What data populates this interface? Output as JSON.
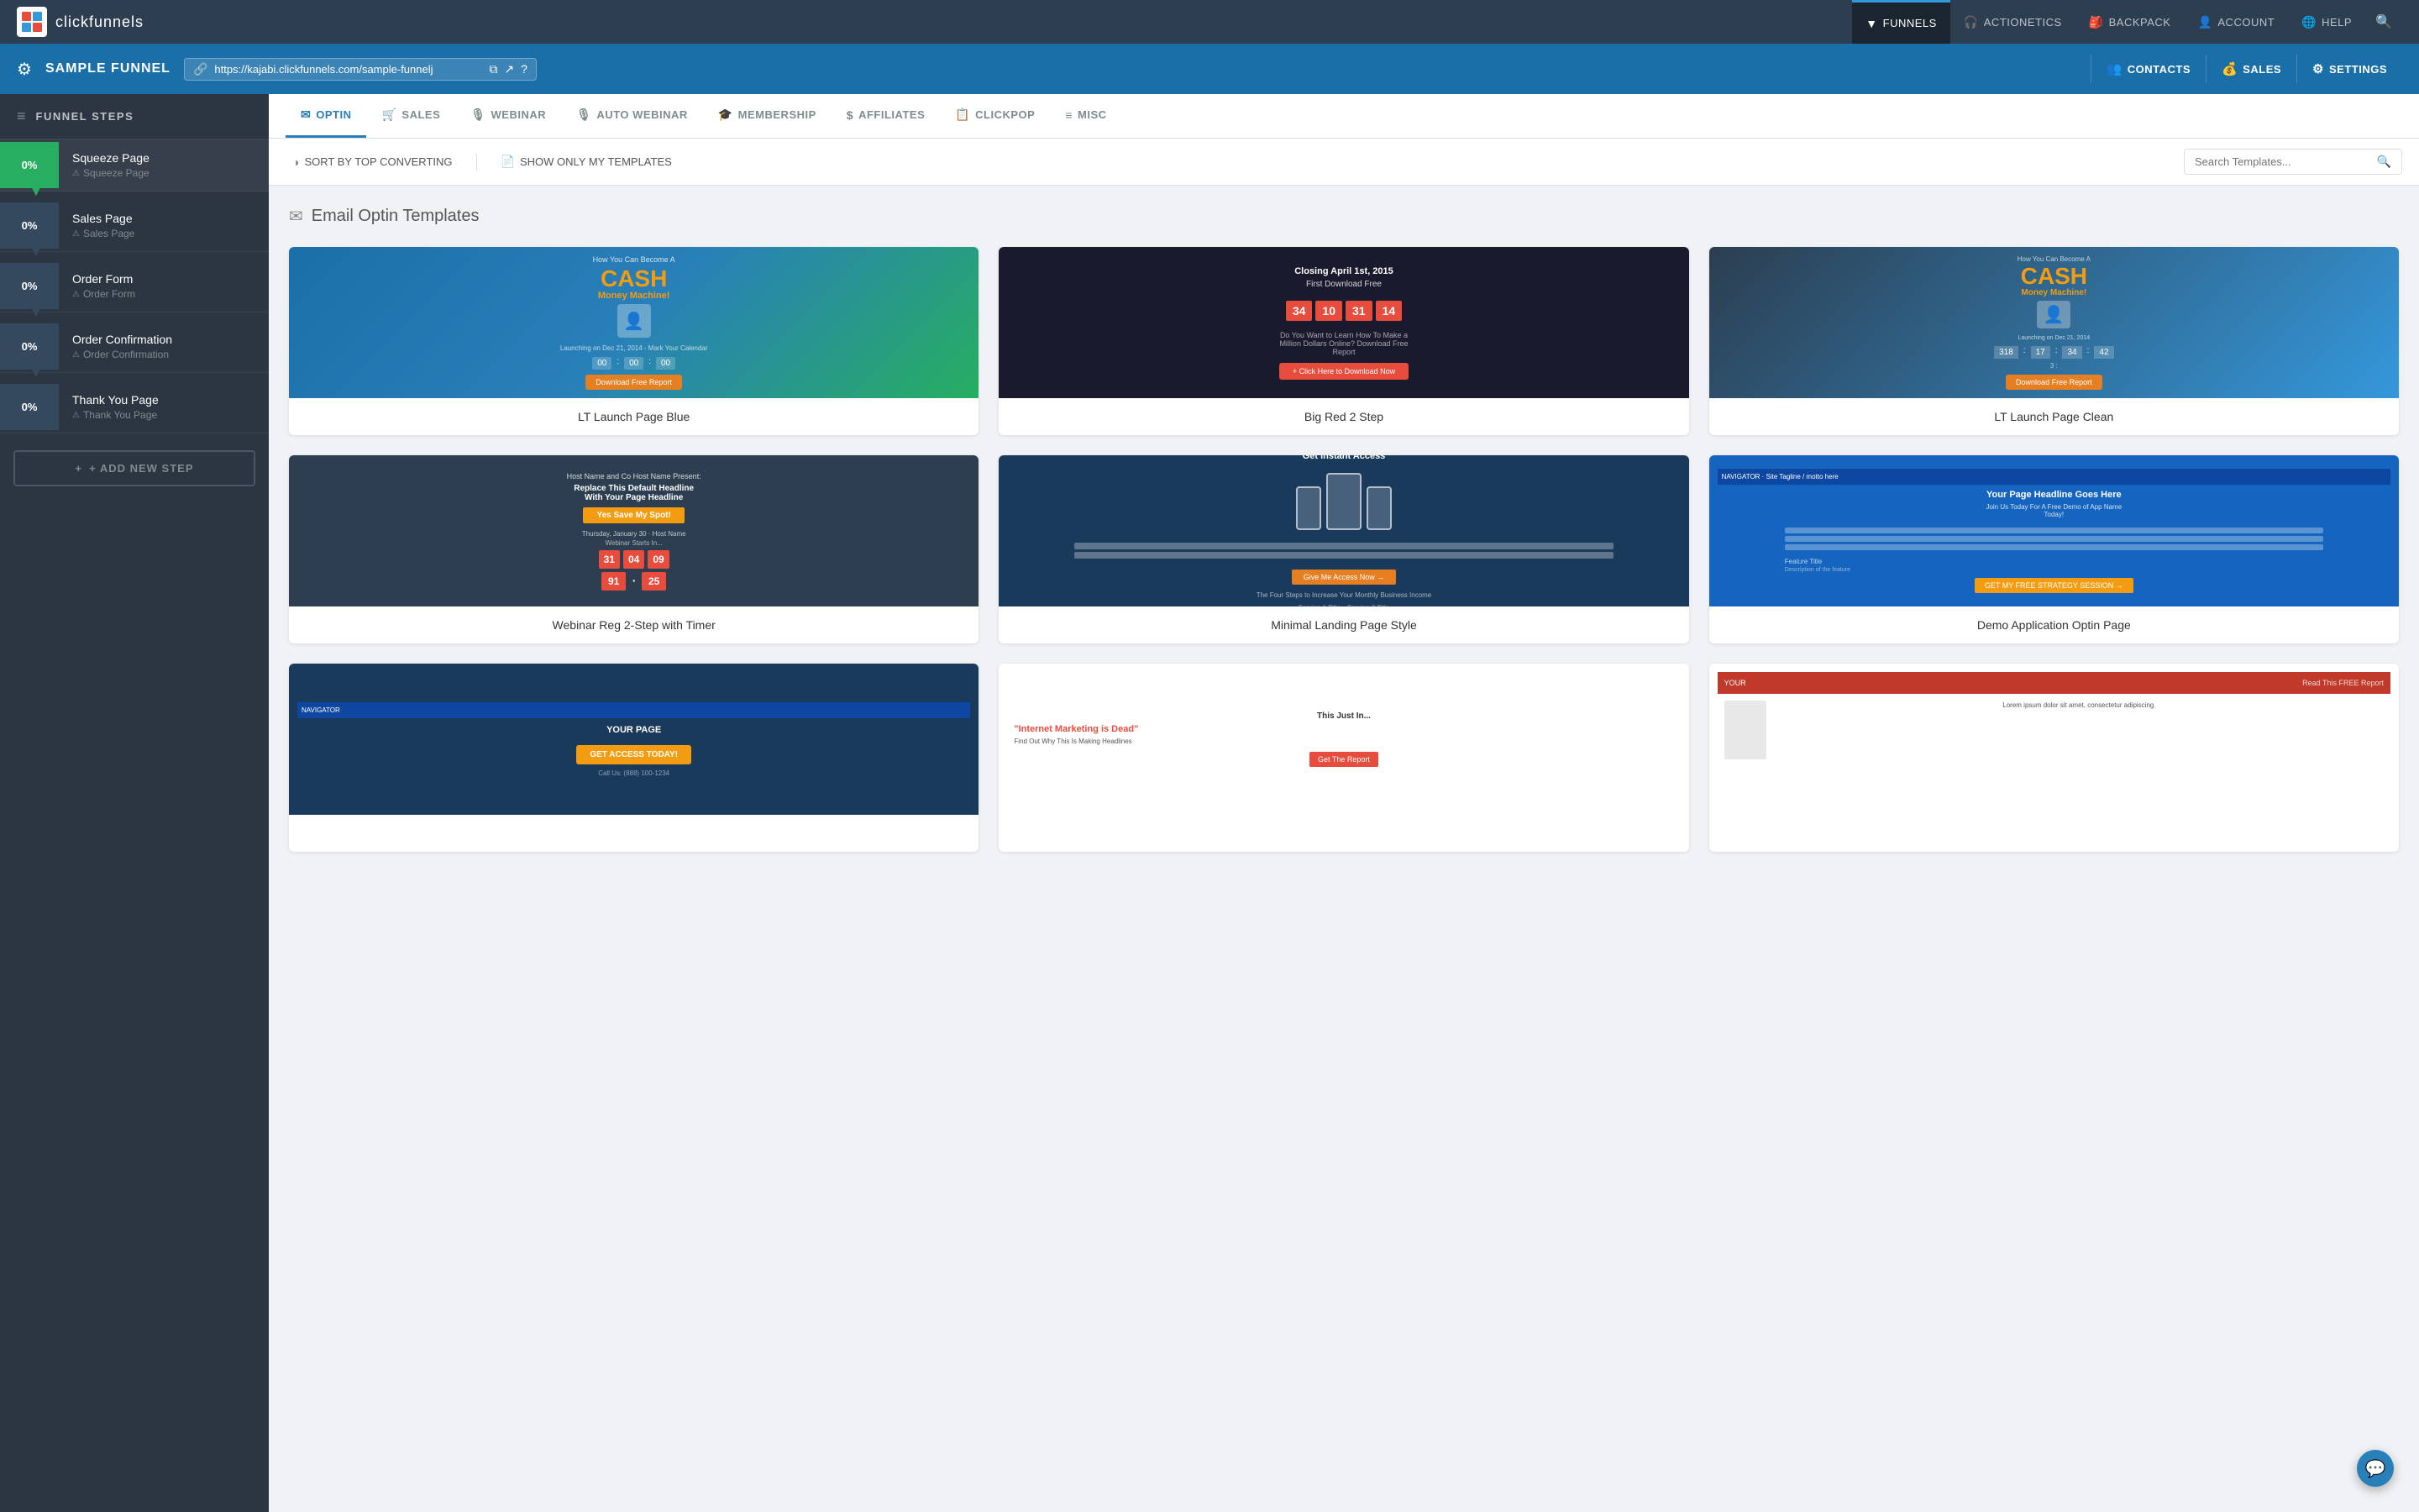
{
  "app": {
    "logo_icon": "CF",
    "logo_text": "clickfunnels"
  },
  "top_nav": {
    "items": [
      {
        "id": "funnels",
        "label": "FUNNELS",
        "icon": "▼",
        "active": true
      },
      {
        "id": "actionetics",
        "label": "ACTIONETICS",
        "icon": "🎧"
      },
      {
        "id": "backpack",
        "label": "BACKPACK",
        "icon": "🎒"
      },
      {
        "id": "account",
        "label": "ACCOUNT",
        "icon": "👤"
      },
      {
        "id": "help",
        "label": "HELP",
        "icon": "🌐"
      }
    ],
    "search_icon": "🔍"
  },
  "funnel_header": {
    "gear_icon": "⚙",
    "title": "SAMPLE FUNNEL",
    "url": "https://kajabi.clickfunnels.com/sample-funnelj",
    "url_icon": "🔗",
    "copy_icon": "⧉",
    "external_icon": "↗",
    "help_icon": "?",
    "buttons": [
      {
        "id": "contacts",
        "label": "CONTACTS",
        "icon": "👥"
      },
      {
        "id": "sales",
        "label": "SALES",
        "icon": "💰"
      },
      {
        "id": "settings",
        "label": "SETTINGS",
        "icon": "⚙"
      }
    ]
  },
  "sidebar": {
    "header_icon": "≡",
    "header_title": "FUNNEL STEPS",
    "steps": [
      {
        "id": "squeeze",
        "name": "Squeeze Page",
        "sub": "Squeeze Page",
        "percent": "0%",
        "active": true
      },
      {
        "id": "sales",
        "name": "Sales Page",
        "sub": "Sales Page",
        "percent": "0%"
      },
      {
        "id": "order-form",
        "name": "Order Form",
        "sub": "Order Form",
        "percent": "0%"
      },
      {
        "id": "order-confirm",
        "name": "Order Confirmation",
        "sub": "Order Confirmation",
        "percent": "0%"
      },
      {
        "id": "thank-you",
        "name": "Thank You Page",
        "sub": "Thank You Page",
        "percent": "0%"
      }
    ],
    "add_step_label": "+ ADD NEW STEP"
  },
  "tabs": [
    {
      "id": "optin",
      "label": "OPTIN",
      "icon": "✉",
      "active": true
    },
    {
      "id": "sales",
      "label": "SALES",
      "icon": "🛒"
    },
    {
      "id": "webinar",
      "label": "WEBINAR",
      "icon": "🎙"
    },
    {
      "id": "auto-webinar",
      "label": "AUTO WEBINAR",
      "icon": "🎙"
    },
    {
      "id": "membership",
      "label": "MEMBERSHIP",
      "icon": "🎓"
    },
    {
      "id": "affiliates",
      "label": "AFFILIATES",
      "icon": "$"
    },
    {
      "id": "clickpop",
      "label": "CLICKPOP",
      "icon": "📋"
    },
    {
      "id": "misc",
      "label": "MISC",
      "icon": "≡"
    }
  ],
  "toolbar": {
    "sort_icon": "◑",
    "sort_label": "SORT BY TOP CONVERTING",
    "show_icon": "📄",
    "show_label": "SHOW ONLY MY TEMPLATES",
    "search_placeholder": "Search Templates...",
    "search_icon": "🔍"
  },
  "templates_section": {
    "icon": "✉",
    "title": "Email Optin Templates"
  },
  "templates": [
    {
      "id": "lt-launch-blue",
      "label": "LT Launch Page Blue",
      "thumb_type": "blue-cash"
    },
    {
      "id": "big-red-2step",
      "label": "Big Red 2 Step",
      "thumb_type": "dark-countdown"
    },
    {
      "id": "lt-launch-clean",
      "label": "LT Launch Page Clean",
      "thumb_type": "clean"
    },
    {
      "id": "webinar-reg",
      "label": "Webinar Reg 2-Step with Timer",
      "thumb_type": "webinar"
    },
    {
      "id": "minimal-landing",
      "label": "Minimal Landing Page Style",
      "thumb_type": "minimal"
    },
    {
      "id": "demo-application",
      "label": "Demo Application Optin Page",
      "thumb_type": "demo"
    }
  ],
  "bottom_templates": [
    {
      "id": "navigator",
      "thumb_type": "navigator"
    },
    {
      "id": "news",
      "thumb_type": "news"
    },
    {
      "id": "cover",
      "thumb_type": "cover"
    }
  ]
}
